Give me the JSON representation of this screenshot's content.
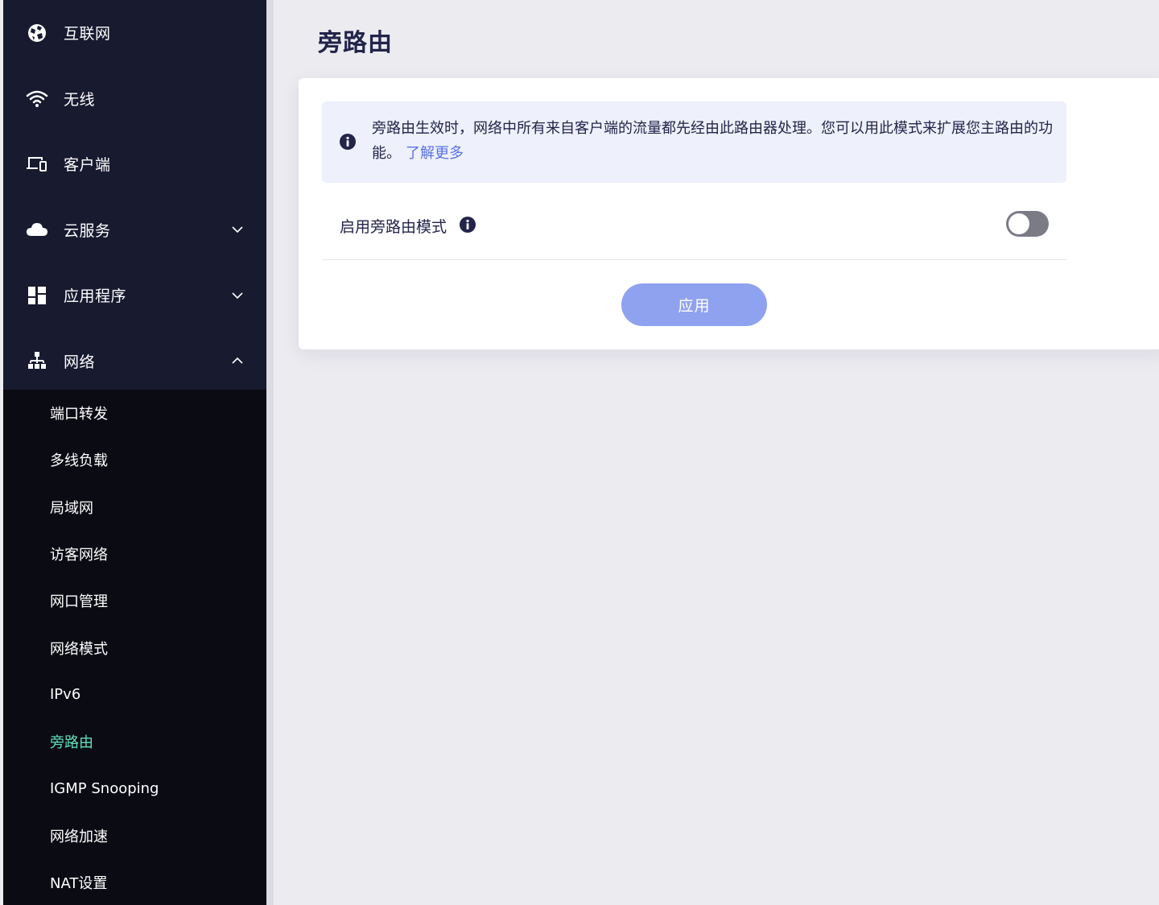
{
  "sidebar": {
    "items": [
      {
        "label": "互联网",
        "icon": "globe-icon",
        "expandable": false
      },
      {
        "label": "无线",
        "icon": "wifi-icon",
        "expandable": false
      },
      {
        "label": "客户端",
        "icon": "devices-icon",
        "expandable": false
      },
      {
        "label": "云服务",
        "icon": "cloud-icon",
        "expandable": true,
        "expanded": false
      },
      {
        "label": "应用程序",
        "icon": "apps-grid-icon",
        "expandable": true,
        "expanded": false
      },
      {
        "label": "网络",
        "icon": "network-tree-icon",
        "expandable": true,
        "expanded": true
      }
    ],
    "sub_items": [
      {
        "label": "端口转发"
      },
      {
        "label": "多线负载"
      },
      {
        "label": "局域网"
      },
      {
        "label": "访客网络"
      },
      {
        "label": "网口管理"
      },
      {
        "label": "网络模式"
      },
      {
        "label": "IPv6"
      },
      {
        "label": "旁路由",
        "active": true
      },
      {
        "label": "IGMP Snooping"
      },
      {
        "label": "网络加速"
      },
      {
        "label": "NAT设置"
      }
    ]
  },
  "main": {
    "title": "旁路由",
    "info": {
      "text": "旁路由生效时，网络中所有来自客户端的流量都先经由此路由器处理。您可以用此模式来扩展您主路由的功能。",
      "link": "了解更多"
    },
    "setting": {
      "label": "启用旁路由模式",
      "enabled": false
    },
    "apply_label": "应用"
  },
  "colors": {
    "sidebar_bg": "#0b0b14",
    "sidebar_top_bg": "#181a30",
    "active_sub": "#5ee0b8",
    "title": "#23244a",
    "link": "#5a72e6",
    "button": "#8fa2f0",
    "info_bg": "#eef0fb",
    "toggle_off": "#7b7b86"
  }
}
